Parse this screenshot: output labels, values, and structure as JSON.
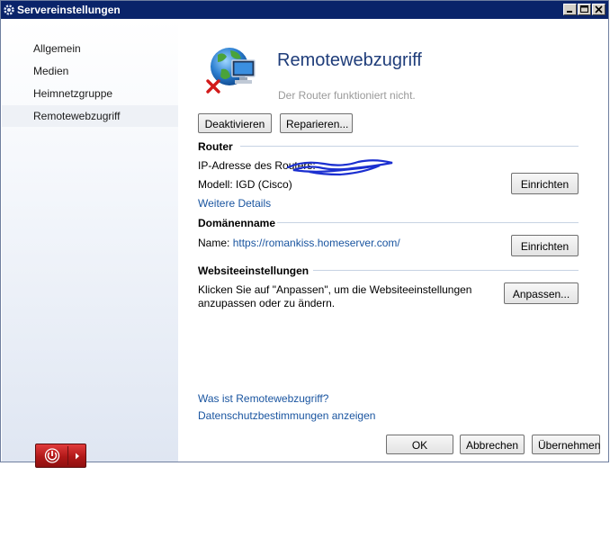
{
  "window": {
    "title": "Servereinstellungen"
  },
  "sidebar": {
    "items": [
      {
        "label": "Allgemein"
      },
      {
        "label": "Medien"
      },
      {
        "label": "Heimnetzgruppe"
      },
      {
        "label": "Remotewebzugriff",
        "active": true
      }
    ]
  },
  "main": {
    "title": "Remotewebzugriff",
    "status": "Der Router funktioniert nicht.",
    "buttons": {
      "deactivate": "Deaktivieren",
      "repair": "Reparieren..."
    },
    "router": {
      "heading": "Router",
      "ip_label": "IP-Adresse des Routers:",
      "model_label": "Modell:",
      "model_value": "IGD (Cisco)",
      "setup_button": "Einrichten",
      "more_details_link": "Weitere Details"
    },
    "domain": {
      "heading": "Domänenname",
      "name_label": "Name:",
      "name_value": "https://romankiss.homeserver.com/",
      "setup_button": "Einrichten"
    },
    "website": {
      "heading": "Websiteeinstellungen",
      "description_line1": "Klicken Sie auf \"Anpassen\", um die Websiteeinstellungen",
      "description_line2": "anzupassen oder zu ändern.",
      "customize_button": "Anpassen..."
    },
    "links": {
      "what_is": "Was ist Remotewebzugriff?",
      "privacy": "Datenschutzbestimmungen anzeigen"
    }
  },
  "footer": {
    "ok": "OK",
    "cancel": "Abbrechen",
    "apply": "Übernehmen"
  },
  "colors": {
    "titlebar": "#0a246a",
    "title_text": "#1f3d7a",
    "link": "#1a55a0",
    "power_button": "#c42020"
  },
  "icons": [
    "settings-app-icon",
    "globe-computer-icon",
    "error-x-icon",
    "power-icon",
    "arrow-right-icon"
  ]
}
